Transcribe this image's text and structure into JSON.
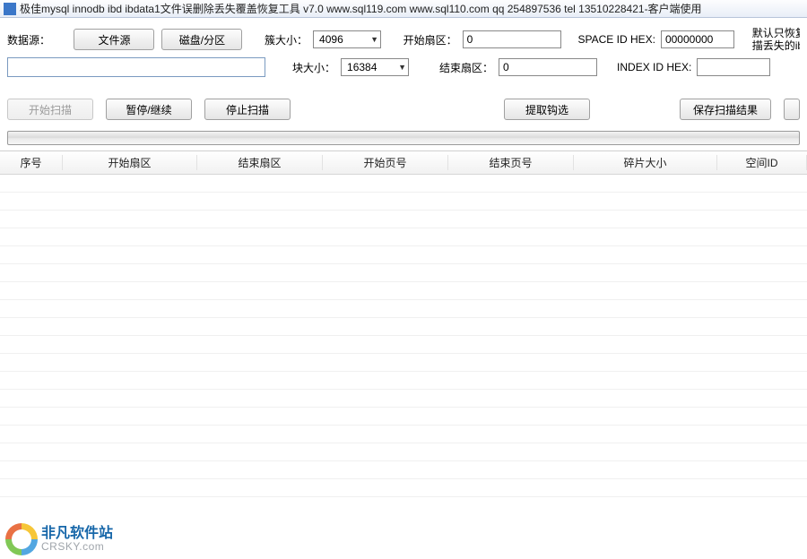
{
  "titlebar": "极佳mysql innodb ibd ibdata1文件误删除丢失覆盖恢复工具 v7.0 www.sql119.com www.sql110.com qq 254897536 tel 13510228421-客户端使用",
  "labels": {
    "datasource": "数据源：",
    "cluster_size": "簇大小：",
    "block_size": "块大小：",
    "start_sector": "开始扇区：",
    "end_sector": "结束扇区：",
    "space_id_hex": "SPACE ID HEX:",
    "index_id_hex": "INDEX ID HEX:"
  },
  "buttons": {
    "file_source": "文件源",
    "disk_partition": "磁盘/分区",
    "start_scan": "开始扫描",
    "pause_resume": "暂停/继续",
    "stop_scan": "停止扫描",
    "extract_checked": "提取钩选",
    "save_scan_result": "保存扫描结果"
  },
  "inputs": {
    "datasource_value": "",
    "cluster_size_value": "4096",
    "block_size_value": "16384",
    "start_sector_value": "0",
    "end_sector_value": "0",
    "space_id_hex_value": "00000000",
    "index_id_hex_value": ""
  },
  "note_line1": "默认只恢复丢失ibda",
  "note_line2": "描丢失的ibd文件请把",
  "columns": {
    "seq": "序号",
    "start_sector": "开始扇区",
    "end_sector": "结束扇区",
    "start_page": "开始页号",
    "end_page": "结束页号",
    "fragment_size": "碎片大小",
    "space_id": "空间ID"
  },
  "watermark": {
    "cn": "非凡软件站",
    "en": "CRSKY.com"
  }
}
